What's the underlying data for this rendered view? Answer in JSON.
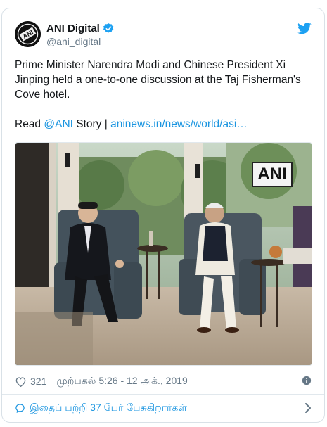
{
  "account": {
    "display_name": "ANI Digital",
    "handle": "@ani_digital",
    "avatar_text": "ANI"
  },
  "tweet": {
    "line1": "Prime Minister Narendra Modi and Chinese President Xi",
    "line2": "Jinping held a one-to-one discussion at the Taj Fisherman's",
    "line3": "Cove hotel.",
    "read_prefix": "Read ",
    "mention": "@ANI",
    "story_sep": " Story | ",
    "link_text": "aninews.in/news/world/asi…"
  },
  "media": {
    "watermark": "ANI"
  },
  "meta": {
    "likes": "321",
    "timestamp": "முற்பகல் 5:26 - 12 அக்., 2019"
  },
  "footer": {
    "replies_text": "இதைப் பற்றி 37 பேர் பேசுகிறார்கள்"
  },
  "colors": {
    "link": "#1b95e0",
    "secondary_text": "#657786",
    "border": "#e1e8ed"
  },
  "icons": [
    "verified-badge-icon",
    "twitter-bird-icon",
    "heart-icon",
    "info-icon",
    "comment-icon",
    "chevron-right-icon"
  ]
}
